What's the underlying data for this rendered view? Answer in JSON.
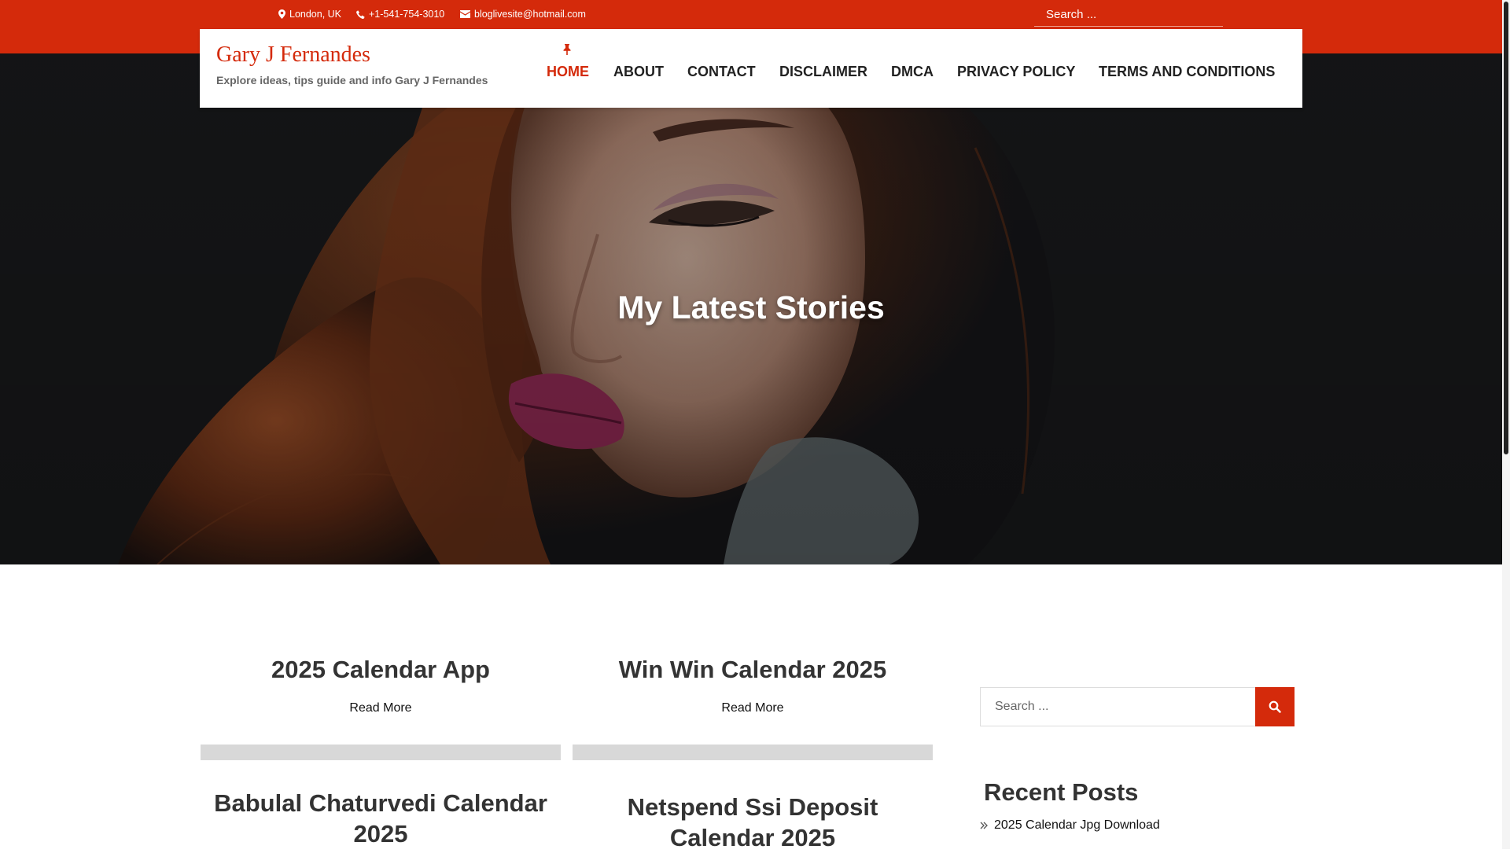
{
  "topbar": {
    "location": "London, UK",
    "phone": "+1-541-754-3010",
    "email": "bloglivesite@hotmail.com",
    "search_placeholder": "Search ..."
  },
  "header": {
    "site_title": "Gary J Fernandes",
    "tagline": "Explore ideas, tips guide and info Gary J Fernandes",
    "nav": [
      "HOME",
      "ABOUT",
      "CONTACT",
      "DISCLAIMER",
      "DMCA",
      "PRIVACY POLICY",
      "TERMS AND CONDITIONS"
    ],
    "active_nav": "HOME"
  },
  "hero": {
    "title": "My Latest Stories"
  },
  "posts": [
    {
      "title": "2025 Calendar App",
      "read_more": "Read More"
    },
    {
      "title": "Win Win Calendar 2025",
      "read_more": "Read More"
    },
    {
      "title": "Babulal Chaturvedi Calendar 2025"
    },
    {
      "title": "Netspend Ssi Deposit Calendar 2025"
    }
  ],
  "sidebar": {
    "search_placeholder": "Search ...",
    "recent_heading": "Recent Posts",
    "recent_posts": [
      "2025 Calendar Jpg Download"
    ]
  },
  "colors": {
    "accent": "#d42a0b",
    "text": "#222222"
  },
  "icons": [
    "map-marker-icon",
    "phone-icon",
    "envelope-icon",
    "pin-icon",
    "search-icon",
    "double-chevron-right-icon"
  ]
}
